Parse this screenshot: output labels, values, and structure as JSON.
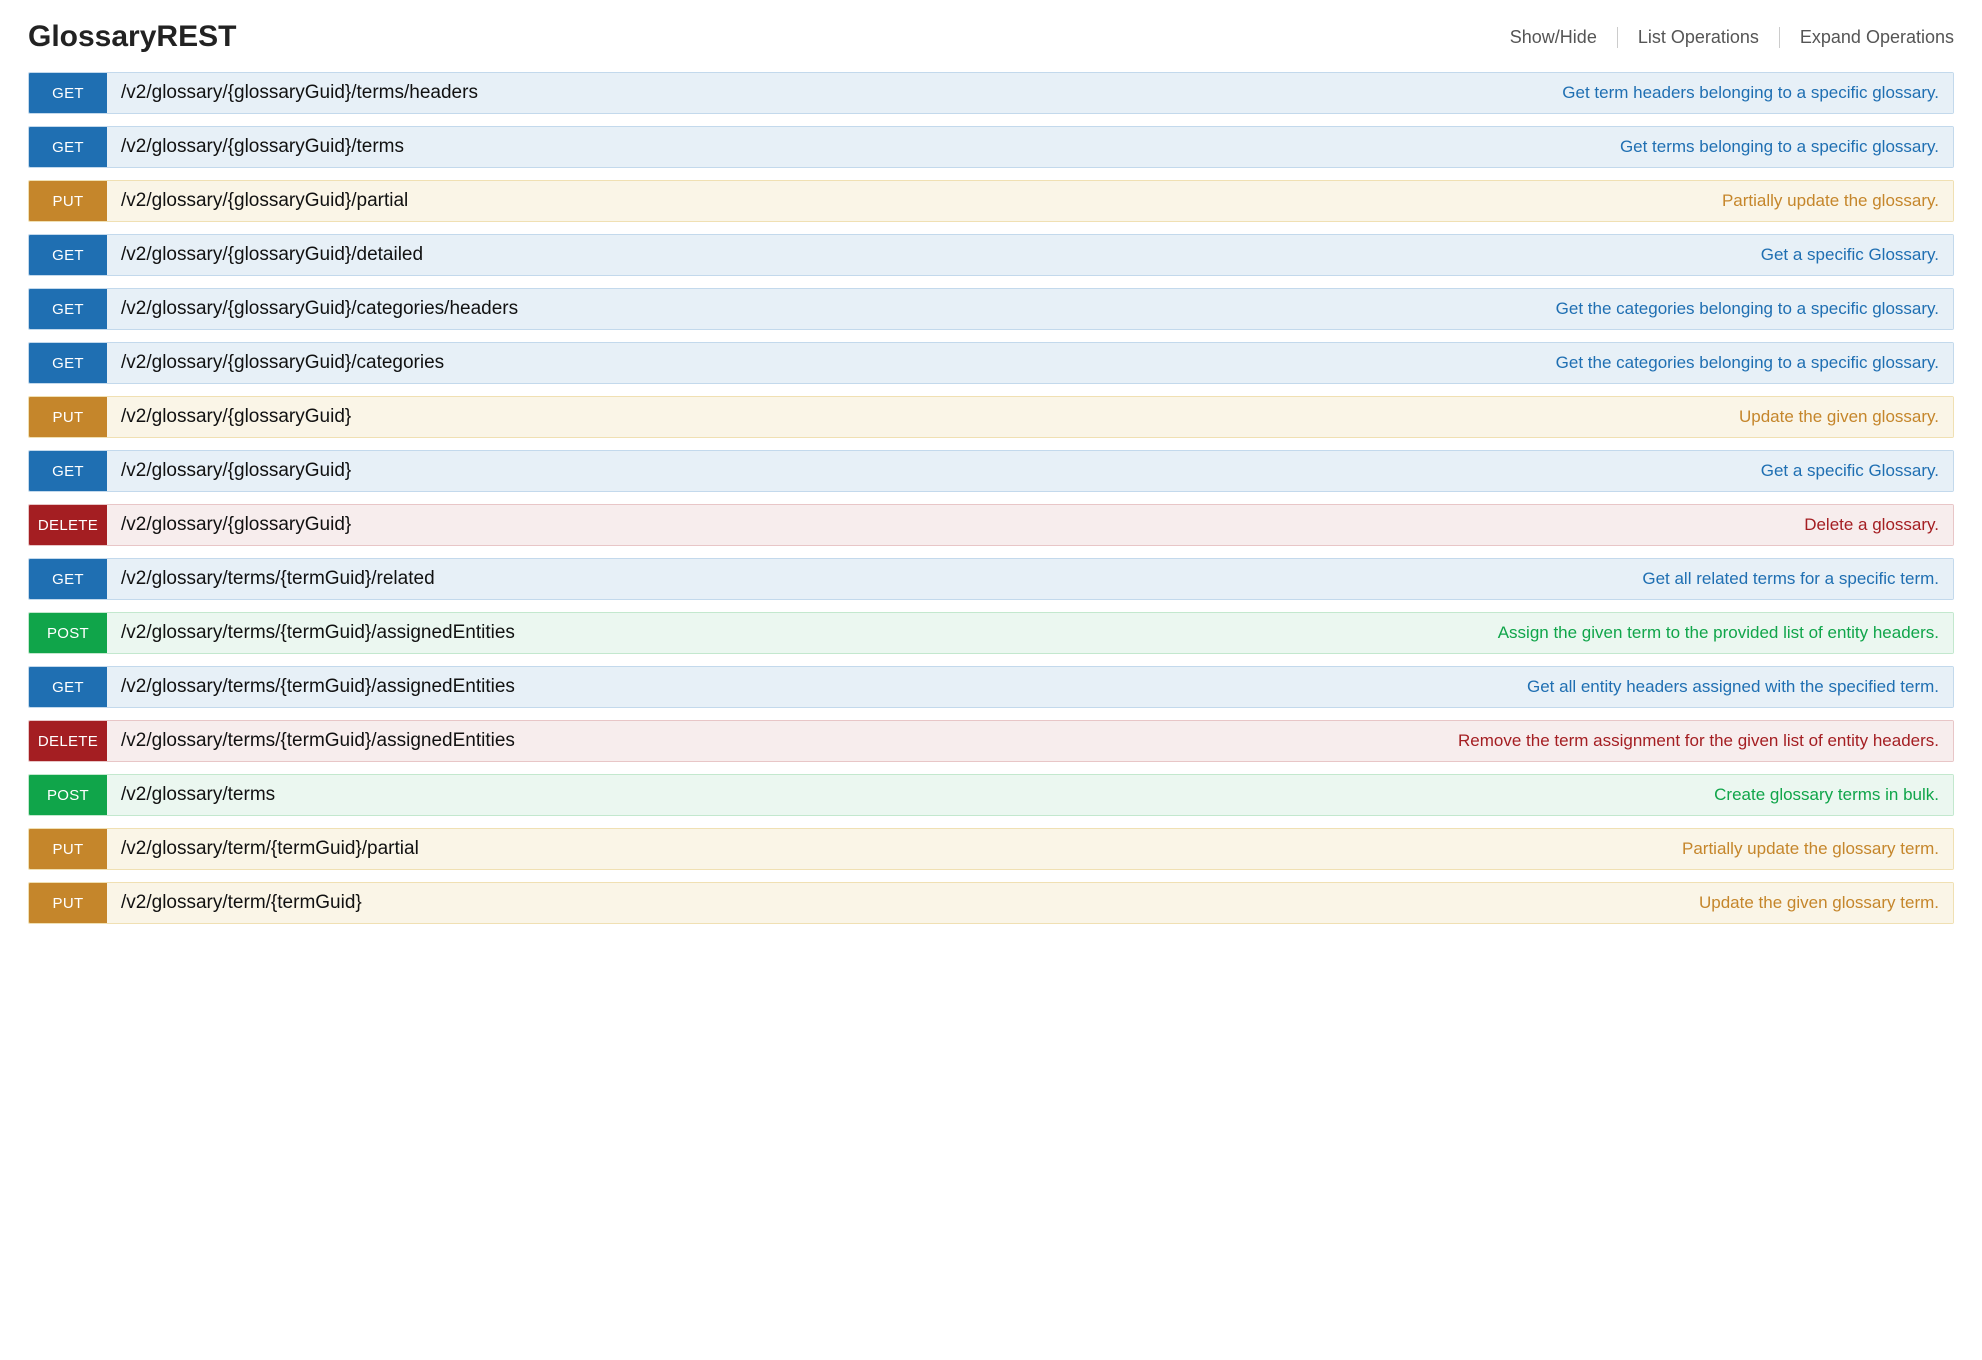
{
  "header": {
    "title": "GlossaryREST",
    "actions": {
      "show_hide": "Show/Hide",
      "list_operations": "List Operations",
      "expand_operations": "Expand Operations"
    }
  },
  "operations": [
    {
      "method": "GET",
      "path": "/v2/glossary/{glossaryGuid}/terms/headers",
      "desc": "Get term headers belonging to a specific glossary."
    },
    {
      "method": "GET",
      "path": "/v2/glossary/{glossaryGuid}/terms",
      "desc": "Get terms belonging to a specific glossary."
    },
    {
      "method": "PUT",
      "path": "/v2/glossary/{glossaryGuid}/partial",
      "desc": "Partially update the glossary."
    },
    {
      "method": "GET",
      "path": "/v2/glossary/{glossaryGuid}/detailed",
      "desc": "Get a specific Glossary."
    },
    {
      "method": "GET",
      "path": "/v2/glossary/{glossaryGuid}/categories/headers",
      "desc": "Get the categories belonging to a specific glossary."
    },
    {
      "method": "GET",
      "path": "/v2/glossary/{glossaryGuid}/categories",
      "desc": "Get the categories belonging to a specific glossary."
    },
    {
      "method": "PUT",
      "path": "/v2/glossary/{glossaryGuid}",
      "desc": "Update the given glossary."
    },
    {
      "method": "GET",
      "path": "/v2/glossary/{glossaryGuid}",
      "desc": "Get a specific Glossary."
    },
    {
      "method": "DELETE",
      "path": "/v2/glossary/{glossaryGuid}",
      "desc": "Delete a glossary."
    },
    {
      "method": "GET",
      "path": "/v2/glossary/terms/{termGuid}/related",
      "desc": "Get all related terms for a specific term."
    },
    {
      "method": "POST",
      "path": "/v2/glossary/terms/{termGuid}/assignedEntities",
      "desc": "Assign the given term to the provided list of entity headers."
    },
    {
      "method": "GET",
      "path": "/v2/glossary/terms/{termGuid}/assignedEntities",
      "desc": "Get all entity headers assigned with the specified term."
    },
    {
      "method": "DELETE",
      "path": "/v2/glossary/terms/{termGuid}/assignedEntities",
      "desc": "Remove the term assignment for the given list of entity headers."
    },
    {
      "method": "POST",
      "path": "/v2/glossary/terms",
      "desc": "Create glossary terms in bulk."
    },
    {
      "method": "PUT",
      "path": "/v2/glossary/term/{termGuid}/partial",
      "desc": "Partially update the glossary term."
    },
    {
      "method": "PUT",
      "path": "/v2/glossary/term/{termGuid}",
      "desc": "Update the given glossary term."
    }
  ]
}
